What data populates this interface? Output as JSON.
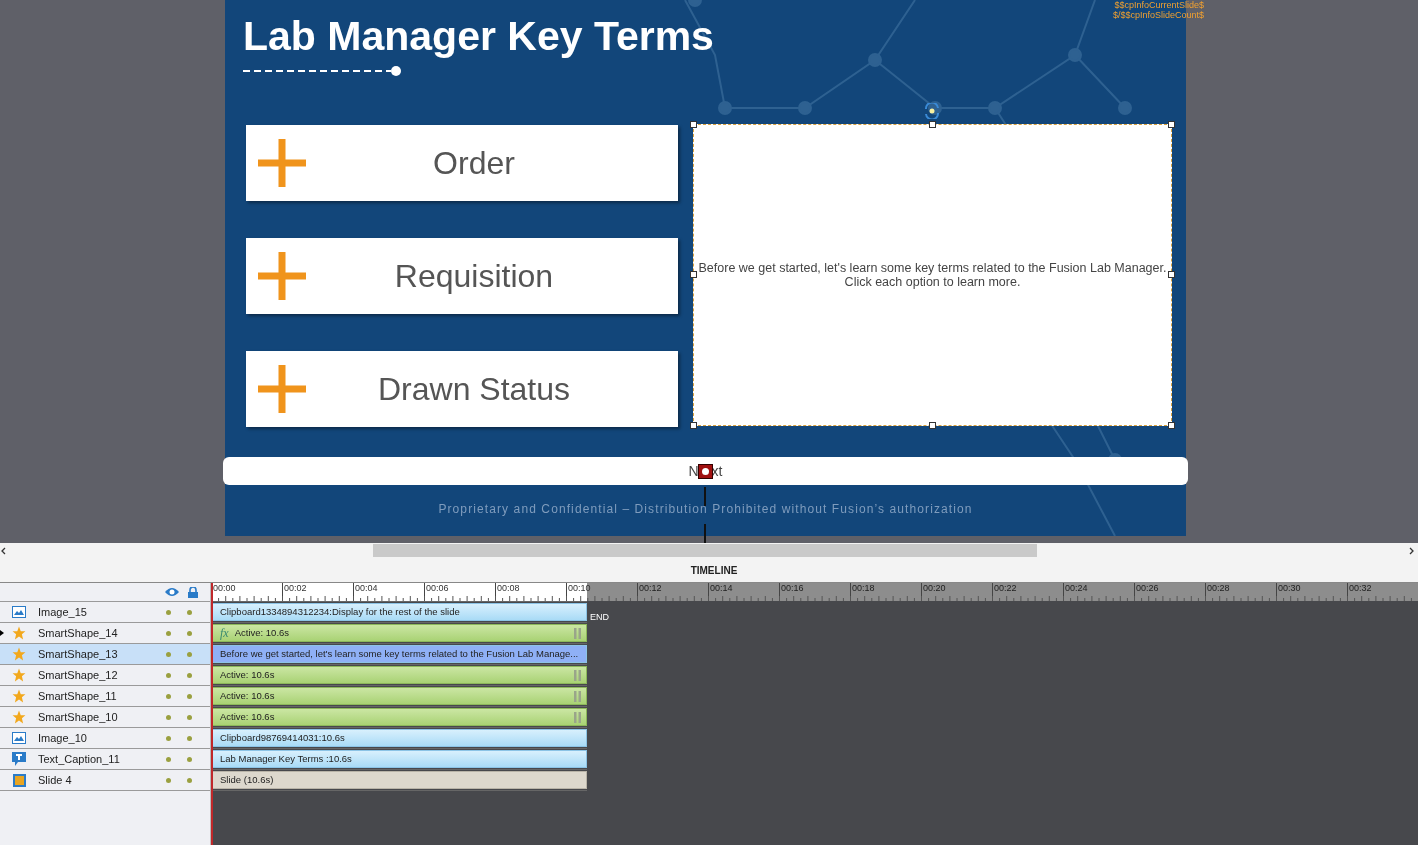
{
  "slide": {
    "title": "Lab Manager Key Terms",
    "counters": [
      "$$cpInfoCurrentSlide$",
      "$/$$cpInfoSlideCount$"
    ],
    "options": [
      {
        "label": "Order"
      },
      {
        "label": "Requisition"
      },
      {
        "label": "Drawn Status"
      }
    ],
    "text_box": {
      "lines": [
        "Before we get started, let's learn some key terms related to the Fusion Lab Manager.",
        "Click each option to learn more."
      ],
      "selected": true
    },
    "next_button": [
      "N",
      "xt"
    ],
    "footer": "Proprietary and Confidential – Distribution Prohibited without Fusion’s authorization"
  },
  "timeline": {
    "title": "TIMELINE",
    "ticks": [
      "00:00",
      "00:02",
      "00:04",
      "00:06",
      "00:08",
      "00:10",
      "00:12",
      "00:14",
      "00:16",
      "00:18",
      "00:20",
      "00:22",
      "00:24",
      "00:26",
      "00:28",
      "00:30",
      "00:32"
    ],
    "end_label": "END",
    "layers": [
      {
        "name": "Image_15",
        "kind": "image",
        "selected": false,
        "pointer": false,
        "bar": {
          "kind": "media",
          "text": "Clipboard1334894312234:Display for the rest of the slide",
          "grip": false
        }
      },
      {
        "name": "SmartShape_14",
        "kind": "shape",
        "selected": false,
        "pointer": true,
        "bar": {
          "kind": "active",
          "effect": "fx",
          "text": "Active: 10.6s",
          "grip": true
        }
      },
      {
        "name": "SmartShape_13",
        "kind": "shape",
        "selected": true,
        "pointer": false,
        "bar": {
          "kind": "media",
          "text": "Before we get started, let's learn some key terms related to the Fusion Lab Manage...",
          "grip": false
        }
      },
      {
        "name": "SmartShape_12",
        "kind": "shape",
        "selected": false,
        "pointer": false,
        "bar": {
          "kind": "active",
          "text": "Active: 10.6s",
          "grip": true
        }
      },
      {
        "name": "SmartShape_11",
        "kind": "shape",
        "selected": false,
        "pointer": false,
        "bar": {
          "kind": "active",
          "text": "Active: 10.6s",
          "grip": true
        }
      },
      {
        "name": "SmartShape_10",
        "kind": "shape",
        "selected": false,
        "pointer": false,
        "bar": {
          "kind": "active",
          "text": "Active: 10.6s",
          "grip": true
        }
      },
      {
        "name": "Image_10",
        "kind": "image",
        "selected": false,
        "pointer": false,
        "bar": {
          "kind": "media",
          "text": "Clipboard98769414031:10.6s",
          "grip": false
        }
      },
      {
        "name": "Text_Caption_11",
        "kind": "caption",
        "selected": false,
        "pointer": false,
        "bar": {
          "kind": "media",
          "text": "Lab Manager Key Terms  :10.6s",
          "grip": false
        }
      },
      {
        "name": "Slide 4",
        "kind": "slide",
        "selected": false,
        "pointer": false,
        "bar": {
          "kind": "slide",
          "text": "Slide (10.6s)",
          "grip": false
        }
      }
    ]
  }
}
